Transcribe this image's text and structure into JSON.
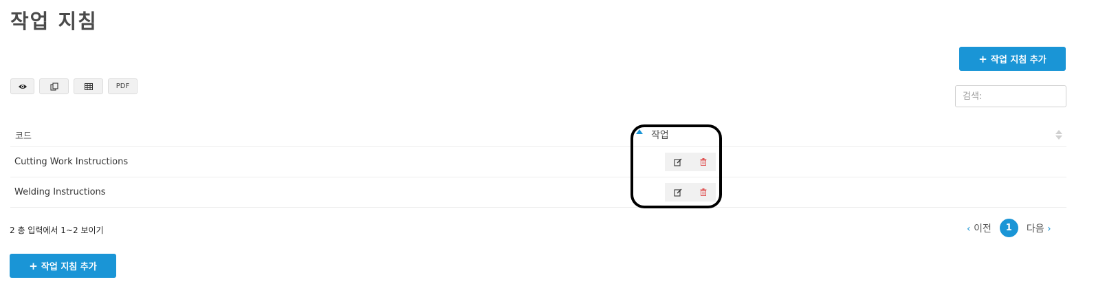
{
  "page": {
    "title": "작업 지침"
  },
  "toolbar": {
    "add_label": "작업 지침 추가",
    "export_buttons": [
      {
        "icon": "eye-icon"
      },
      {
        "icon": "copy-icon"
      },
      {
        "icon": "table-icon"
      },
      {
        "label": "PDF"
      }
    ]
  },
  "search": {
    "placeholder": "검색:"
  },
  "table": {
    "columns": {
      "code": "코드",
      "action": "작업"
    },
    "rows": [
      {
        "code": "Cutting Work Instructions"
      },
      {
        "code": "Welding Instructions"
      }
    ]
  },
  "footer": {
    "info": "2 총 입력에서 1~2 보이기",
    "pagination": {
      "prev": "이전",
      "current": "1",
      "next": "다음"
    }
  },
  "colors": {
    "accent": "#1a95d6",
    "delete": "#e05555"
  }
}
